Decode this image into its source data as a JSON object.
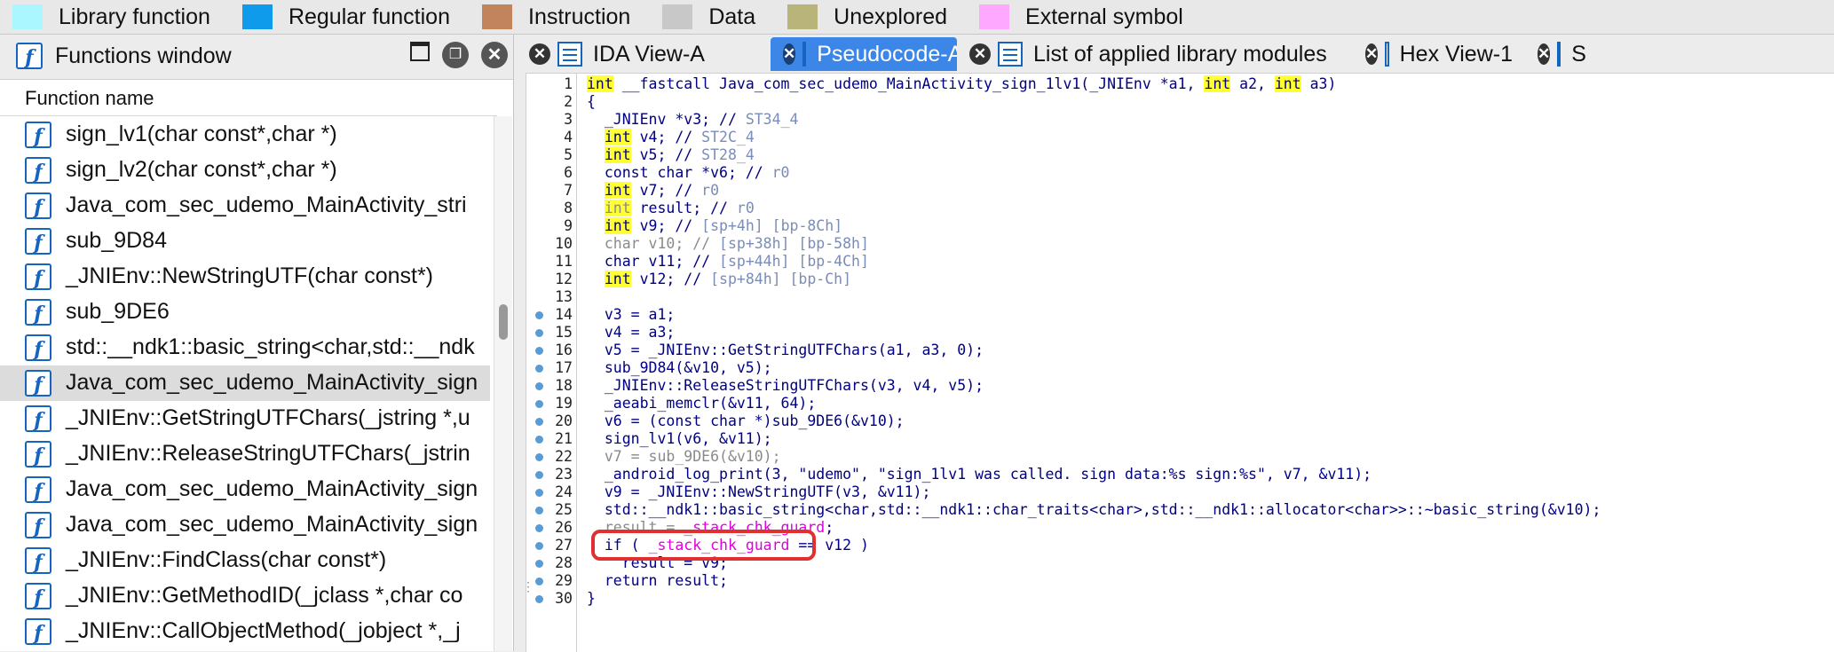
{
  "legend": [
    {
      "label": "Library function",
      "color": "#aaf7ff"
    },
    {
      "label": "Regular function",
      "color": "#0e9bec"
    },
    {
      "label": "Instruction",
      "color": "#c1845c"
    },
    {
      "label": "Data",
      "color": "#c8c8c8"
    },
    {
      "label": "Unexplored",
      "color": "#b8b47a"
    },
    {
      "label": "External symbol",
      "color": "#ffa8ff"
    }
  ],
  "functions_window": {
    "title": "Functions window",
    "column_header": "Function name",
    "items": [
      "sign_lv1(char const*,char *)",
      "sign_lv2(char const*,char *)",
      "Java_com_sec_udemo_MainActivity_stri",
      "sub_9D84",
      "_JNIEnv::NewStringUTF(char const*)",
      "sub_9DE6",
      "std::__ndk1::basic_string<char,std::__ndk",
      "Java_com_sec_udemo_MainActivity_sign",
      "_JNIEnv::GetStringUTFChars(_jstring *,u",
      "_JNIEnv::ReleaseStringUTFChars(_jstrin",
      "Java_com_sec_udemo_MainActivity_sign",
      "Java_com_sec_udemo_MainActivity_sign",
      "_JNIEnv::FindClass(char const*)",
      "_JNIEnv::GetMethodID(_jclass *,char co",
      "_JNIEnv::CallObjectMethod(_jobject *,_j"
    ],
    "selected_index": 7
  },
  "tabs": [
    {
      "label": "IDA View-A",
      "active": false,
      "icon": "ida-view-icon"
    },
    {
      "label": "Pseudocode-A",
      "active": true,
      "icon": "pseudocode-icon"
    },
    {
      "label": "List of applied library modules",
      "active": false,
      "icon": "library-modules-icon"
    },
    {
      "label": "Hex View-1",
      "active": false,
      "icon": "hex-view-icon"
    },
    {
      "label": "S",
      "active": false,
      "icon": "structures-icon"
    }
  ],
  "code": {
    "line_numbers": [
      "1",
      "2",
      "3",
      "4",
      "5",
      "6",
      "7",
      "8",
      "9",
      "10",
      "11",
      "12",
      "13",
      "14",
      "15",
      "16",
      "17",
      "18",
      "19",
      "20",
      "21",
      "22",
      "23",
      "24",
      "25",
      "26",
      "27",
      "28",
      "29",
      "30"
    ],
    "breakpoint_lines": [
      14,
      15,
      16,
      17,
      18,
      19,
      20,
      21,
      22,
      23,
      24,
      25,
      26,
      27,
      28,
      29,
      30
    ],
    "l1_kw": "int",
    "l1_a": " __fastcall Java_com_sec_udemo_MainActivity_sign_1lv1(_JNIEnv *a1, ",
    "l1_kw2": "int",
    "l1_b": " a2, ",
    "l1_kw3": "int",
    "l1_c": " a3)",
    "l2": "{",
    "l3_a": "  _JNIEnv *v3; // ",
    "l3_c": "ST34_4",
    "l4_kw": "int",
    "l4_a": " v4; // ",
    "l4_c": "ST2C_4",
    "l5_kw": "int",
    "l5_a": " v5; // ",
    "l5_c": "ST28_4",
    "l6_a": "  const char *v6; // ",
    "l6_c": "r0",
    "l7_kw": "int",
    "l7_a": " v7; // ",
    "l7_c": "r0",
    "l8_kw": "int",
    "l8_a": " result; // ",
    "l8_c": "r0",
    "l9_kw": "int",
    "l9_a": " v9; // ",
    "l9_c": "[sp+4h] [bp-8Ch]",
    "l10_a": "  char v10; // ",
    "l10_c": "[sp+38h] [bp-58h]",
    "l11_a": "  char v11; // ",
    "l11_c": "[sp+44h] [bp-4Ch]",
    "l12_kw": "int",
    "l12_a": " v12; // ",
    "l12_c": "[sp+84h] [bp-Ch]",
    "l14": "  v3 = a1;",
    "l15": "  v4 = a3;",
    "l16": "  v5 = _JNIEnv::GetStringUTFChars(a1, a3, 0);",
    "l17": "  sub_9D84(&v10, v5);",
    "l18": "  _JNIEnv::ReleaseStringUTFChars(v3, v4, v5);",
    "l19": "  _aeabi_memclr(&v11, 64);",
    "l20": "  v6 = (const char *)sub_9DE6(&v10);",
    "l21": "  sign_lv1(v6, &v11);",
    "l22": "  v7 = sub_9DE6(&v10);",
    "l23": "  _android_log_print(3, \"udemo\", \"sign_1lv1 was called. sign data:%s sign:%s\", v7, &v11);",
    "l24": "  v9 = _JNIEnv::NewStringUTF(v3, &v11);",
    "l25": "  std::__ndk1::basic_string<char,std::__ndk1::char_traits<char>,std::__ndk1::allocator<char>>::~basic_string(&v10);",
    "l26_a": "  result = ",
    "l26_b": "_stack_chk_guard",
    "l26_c": ";",
    "l27_a": "  if ( ",
    "l27_b": "_stack_chk_guard",
    "l27_c": " == v12 )",
    "l28": "    result = v9;",
    "l29": "  return result;",
    "l30": "}"
  }
}
